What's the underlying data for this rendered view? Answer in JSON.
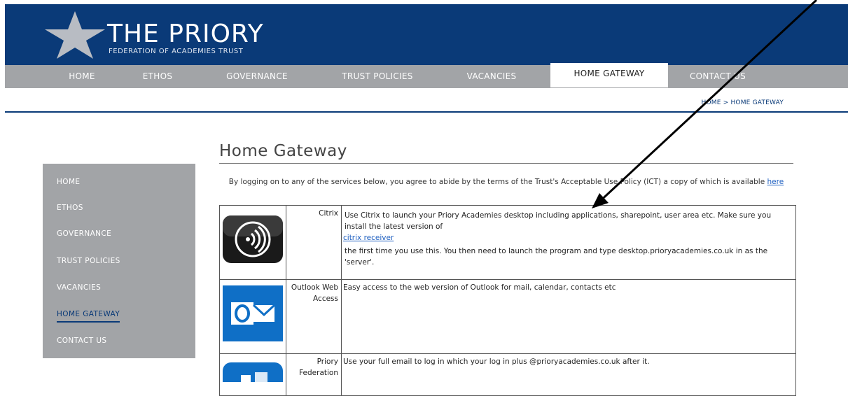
{
  "header": {
    "logo_title": "THE PRIORY",
    "logo_subtitle": "FEDERATION OF ACADEMIES TRUST",
    "brand_color": "#0a3a78"
  },
  "nav": {
    "items": [
      {
        "label": "HOME"
      },
      {
        "label": "ETHOS"
      },
      {
        "label": "GOVERNANCE"
      },
      {
        "label": "TRUST POLICIES"
      },
      {
        "label": "VACANCIES"
      },
      {
        "label": "HOME GATEWAY",
        "active": true
      },
      {
        "label": "CONTACT US"
      }
    ]
  },
  "breadcrumb": {
    "text": "HOME > HOME GATEWAY"
  },
  "sidebar": {
    "items": [
      {
        "label": "HOME"
      },
      {
        "label": "ETHOS"
      },
      {
        "label": "GOVERNANCE"
      },
      {
        "label": "TRUST POLICIES"
      },
      {
        "label": "VACANCIES"
      },
      {
        "label": "HOME GATEWAY",
        "active": true
      },
      {
        "label": "CONTACT US"
      }
    ]
  },
  "main": {
    "title": "Home Gateway",
    "intro_text": "By logging on to any of the services below, you agree to abide by the terms of the Trust's Acceptable Use Policy (ICT) a copy of which is available",
    "intro_link": "here",
    "services": [
      {
        "name": "Citrix",
        "icon": "citrix-icon",
        "desc_before": "Use Citrix to launch your Priory Academies desktop including applications, sharepoint, user area etc. Make sure you install the latest version of",
        "desc_link": "citrix receiver",
        "desc_after": "the first time you use this. You then need to launch the program and type desktop.prioryacademies.co.uk in as the 'server'."
      },
      {
        "name": "Outlook Web Access",
        "icon": "outlook-icon",
        "desc": "Easy access to the web version of Outlook for mail, calendar, contacts etc"
      },
      {
        "name": "Priory Federation",
        "icon": "office365-icon",
        "desc": "Use your full email to log in which your log in plus @prioryacademies.co.uk after it."
      }
    ]
  }
}
